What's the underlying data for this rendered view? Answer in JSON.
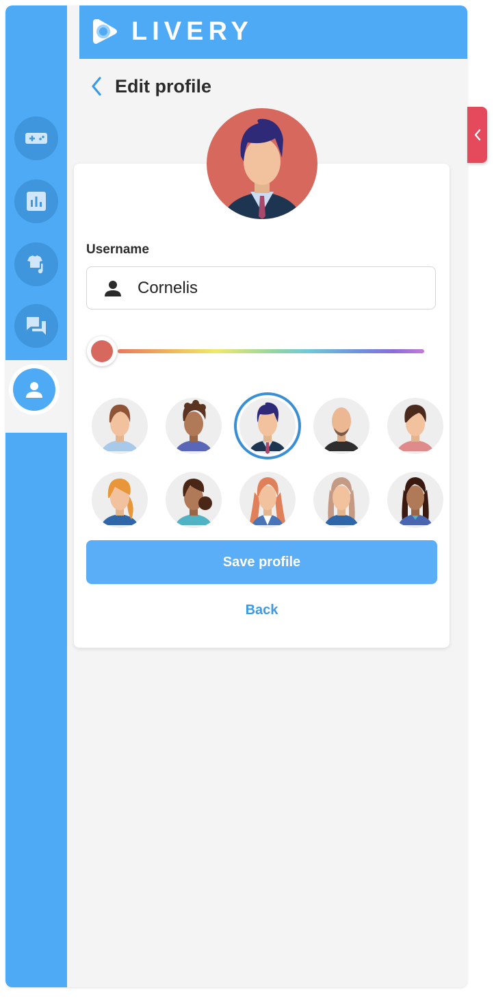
{
  "header": {
    "brand": "LIVERY"
  },
  "page": {
    "title": "Edit profile"
  },
  "form": {
    "username_label": "Username",
    "username_value": "Cornelis",
    "color_value": 0.0,
    "selected_avatar_index": 2
  },
  "nav": {
    "items": [
      {
        "name": "games",
        "icon": "gamepad-icon"
      },
      {
        "name": "leaderboard",
        "icon": "bar-chart-icon"
      },
      {
        "name": "merchandise",
        "icon": "shirt-music-icon"
      },
      {
        "name": "chat",
        "icon": "chat-bubbles-icon"
      },
      {
        "name": "profile",
        "icon": "person-icon",
        "active": true
      }
    ]
  },
  "actions": {
    "save_label": "Save profile",
    "back_label": "Back"
  },
  "colors": {
    "primary": "#4eaaf5",
    "save_button": "#5aadf7",
    "avatar_bg": "#d7685e",
    "side_tab": "#e54a5c",
    "selected_ring": "#3a8fd4"
  }
}
